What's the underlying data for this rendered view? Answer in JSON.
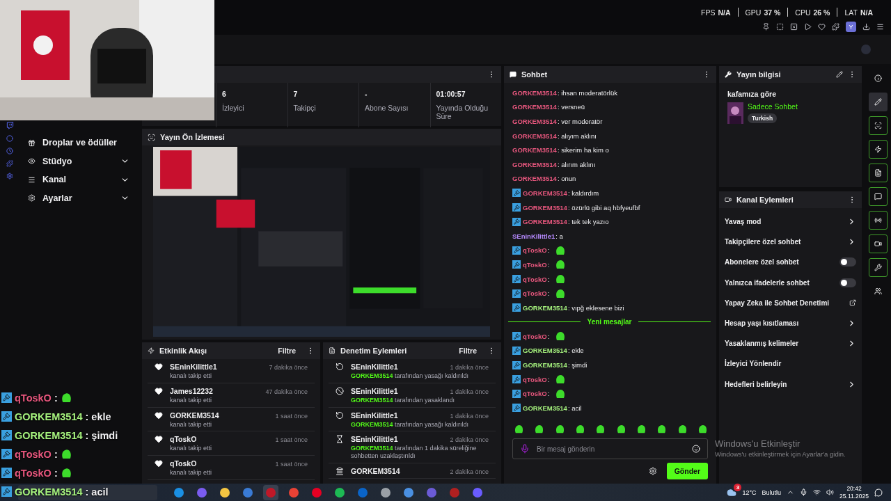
{
  "perf_overlay": [
    {
      "label": "FPS",
      "value": "N/A"
    },
    {
      "label": "GPU",
      "value": "37 %"
    },
    {
      "label": "CPU",
      "value": "26 %"
    },
    {
      "label": "LAT",
      "value": "N/A"
    }
  ],
  "browser_toolbar": {
    "profile": "Y"
  },
  "sidebar": {
    "items": [
      {
        "label": "Droplar ve ödüller",
        "kind": "link"
      },
      {
        "label": "Stüdyo",
        "kind": "group",
        "expanded": false
      },
      {
        "label": "Kanal",
        "kind": "group",
        "expanded": false
      },
      {
        "label": "Ayarlar",
        "kind": "group",
        "expanded": false
      }
    ]
  },
  "stats": [
    {
      "value": "6",
      "label": "İzleyici"
    },
    {
      "value": "7",
      "label": "Takipçi"
    },
    {
      "value": "-",
      "label": "Abone Sayısı"
    },
    {
      "value": "01:00:57",
      "label": "Yayında Olduğu Süre"
    }
  ],
  "preview": {
    "title": "Yayın Ön İzlemesi"
  },
  "activity": {
    "title": "Etkinlik Akışı",
    "filter": "Filtre",
    "items": [
      {
        "user": "SEninKilittle1",
        "action": "kanalı takip etti",
        "time": "7 dakika önce"
      },
      {
        "user": "James12232",
        "action": "kanalı takip etti",
        "time": "47 dakika önce"
      },
      {
        "user": "GORKEM3514",
        "action": "kanalı takip etti",
        "time": "1 saat önce"
      },
      {
        "user": "qToskO",
        "action": "kanalı takip etti",
        "time": "1 saat önce"
      },
      {
        "user": "qToskO",
        "action": "kanalı takip etti",
        "time": "1 saat önce"
      }
    ]
  },
  "moderation": {
    "title": "Denetim Eylemleri",
    "filter": "Filtre",
    "items": [
      {
        "kind": "unban",
        "user": "SEninKilittle1",
        "moderator": "GORKEM3514",
        "action": "tarafından yasağı kaldırıldı",
        "time": "1 dakika önce"
      },
      {
        "kind": "ban",
        "user": "SEninKilittle1",
        "moderator": "GORKEM3514",
        "action": "tarafından yasaklandı",
        "time": "1 dakika önce"
      },
      {
        "kind": "unban",
        "user": "SEninKilittle1",
        "moderator": "GORKEM3514",
        "action": "tarafından yasağı kaldırıldı",
        "time": "1 dakika önce"
      },
      {
        "kind": "timeout",
        "user": "SEninKilittle1",
        "moderator": "GORKEM3514",
        "action": "tarafından 1 dakika süreliğine sohbetten uzaklaştırıldı",
        "time": "2 dakika önce"
      },
      {
        "kind": "other",
        "user": "GORKEM3514",
        "time": "2 dakika önce"
      }
    ]
  },
  "chat": {
    "title": "Sohbet",
    "placeholder": "Bir mesaj gönderin",
    "send": "Gönder",
    "messages": [
      {
        "kind": "message",
        "badge": false,
        "user": "GORKEM3514",
        "color": "#e8577e",
        "text": ": ihsan moderatörlük",
        "emote": false
      },
      {
        "kind": "message",
        "badge": false,
        "user": "GORKEM3514",
        "color": "#e8577e",
        "text": ": versneü",
        "emote": false
      },
      {
        "kind": "message",
        "badge": false,
        "user": "GORKEM3514",
        "color": "#e8577e",
        "text": ": ver moderatör",
        "emote": false
      },
      {
        "kind": "message",
        "badge": false,
        "user": "GORKEM3514",
        "color": "#e8577e",
        "text": ": alıyım aklını",
        "emote": false
      },
      {
        "kind": "message",
        "badge": false,
        "user": "GORKEM3514",
        "color": "#e8577e",
        "text": ": sikerim ha kim o",
        "emote": false
      },
      {
        "kind": "message",
        "badge": false,
        "user": "GORKEM3514",
        "color": "#e8577e",
        "text": ": alırım aklını",
        "emote": false
      },
      {
        "kind": "message",
        "badge": false,
        "user": "GORKEM3514",
        "color": "#e8577e",
        "text": ": onun",
        "emote": false
      },
      {
        "kind": "message",
        "badge": true,
        "user": "GORKEM3514",
        "color": "#e8577e",
        "text": ": kaldırdım",
        "emote": false
      },
      {
        "kind": "message",
        "badge": true,
        "user": "GORKEM3514",
        "color": "#e8577e",
        "text": ": özürlü gibi aq hbfyeufbf",
        "emote": false
      },
      {
        "kind": "message",
        "badge": true,
        "user": "GORKEM3514",
        "color": "#e8577e",
        "text": ": tek tek yazıo",
        "emote": false
      },
      {
        "kind": "message",
        "badge": false,
        "user": "SEninKilittle1",
        "color": "#b68aff",
        "text": ": a",
        "emote": false
      },
      {
        "kind": "message",
        "badge": true,
        "user": "qToskO",
        "color": "#e8577e",
        "text": ":",
        "emote": true
      },
      {
        "kind": "message",
        "badge": true,
        "user": "qToskO",
        "color": "#e8577e",
        "text": ":",
        "emote": true
      },
      {
        "kind": "message",
        "badge": true,
        "user": "qToskO",
        "color": "#e8577e",
        "text": ":",
        "emote": true
      },
      {
        "kind": "message",
        "badge": true,
        "user": "qToskO",
        "color": "#e8577e",
        "text": ":",
        "emote": true
      },
      {
        "kind": "message",
        "badge": true,
        "user": "GORKEM3514",
        "color": "#a6f27e",
        "text": ": vıpğ eklesene bizi",
        "emote": false
      },
      {
        "kind": "divider",
        "text": "Yeni mesajlar"
      },
      {
        "kind": "message",
        "badge": true,
        "user": "qToskO",
        "color": "#e8577e",
        "text": ":",
        "emote": true
      },
      {
        "kind": "message",
        "badge": true,
        "user": "GORKEM3514",
        "color": "#a6f27e",
        "text": ": ekle",
        "emote": false
      },
      {
        "kind": "message",
        "badge": true,
        "user": "GORKEM3514",
        "color": "#a6f27e",
        "text": ": şimdi",
        "emote": false
      },
      {
        "kind": "message",
        "badge": true,
        "user": "qToskO",
        "color": "#e8577e",
        "text": ":",
        "emote": true
      },
      {
        "kind": "message",
        "badge": true,
        "user": "qToskO",
        "color": "#e8577e",
        "text": ":",
        "emote": true
      },
      {
        "kind": "message",
        "badge": true,
        "user": "GORKEM3514",
        "color": "#a6f27e",
        "text": ": acil",
        "emote": false
      }
    ]
  },
  "stream_info": {
    "title": "Yayın bilgisi",
    "stream_title": "kafamıza göre",
    "category": "Sadece Sohbet",
    "tag": "Turkish"
  },
  "channel_actions": {
    "title": "Kanal Eylemleri",
    "items": [
      {
        "label": "Yavaş mod",
        "kind": "submenu"
      },
      {
        "label": "Takipçilere özel sohbet",
        "kind": "submenu"
      },
      {
        "label": "Abonelere özel sohbet",
        "kind": "toggle",
        "on": false
      },
      {
        "label": "Yalnızca ifadelerle sohbet",
        "kind": "toggle",
        "on": false
      },
      {
        "label": "Yapay Zeka ile Sohbet Denetimi",
        "kind": "external"
      },
      {
        "label": "Hesap yaşı kısıtlaması",
        "kind": "submenu"
      },
      {
        "label": "Yasaklanmış kelimeler",
        "kind": "submenu"
      },
      {
        "label": "İzleyici Yönlendir",
        "kind": "plain"
      },
      {
        "label": "Hedefleri belirleyin",
        "kind": "submenu"
      }
    ]
  },
  "right_rail": [
    {
      "kind": "plain",
      "selected": false
    },
    {
      "kind": "plain",
      "selected": true
    },
    {
      "kind": "quick",
      "selected": false
    },
    {
      "kind": "quick",
      "selected": false
    },
    {
      "kind": "quick",
      "selected": false
    },
    {
      "kind": "quick",
      "selected": false
    },
    {
      "kind": "quick",
      "selected": false
    },
    {
      "kind": "quick",
      "selected": false
    },
    {
      "kind": "quick",
      "selected": false
    },
    {
      "kind": "plain",
      "selected": false
    }
  ],
  "overlay_chat": [
    {
      "user": "qToskO",
      "color": "#e8577e",
      "text": ":",
      "emote": true
    },
    {
      "user": "GORKEM3514",
      "color": "#a6f27e",
      "text": ": ekle",
      "emote": false
    },
    {
      "user": "GORKEM3514",
      "color": "#a6f27e",
      "text": ": şimdi",
      "emote": false
    },
    {
      "user": "qToskO",
      "color": "#e8577e",
      "text": ":",
      "emote": true
    },
    {
      "user": "qToskO",
      "color": "#e8577e",
      "text": ":",
      "emote": true
    },
    {
      "user": "GORKEM3514",
      "color": "#a6f27e",
      "text": ": acil",
      "emote": false
    }
  ],
  "activation_notice": {
    "title": "Windows'u Etkinleştir",
    "text": "Windows'u etkinleştirmek için Ayarlar'a gidin."
  },
  "taskbar": {
    "weather_badge": "3",
    "temperature": "12°C",
    "condition": "Bulutlu",
    "time": "20:42",
    "date": "25.11.2025"
  }
}
